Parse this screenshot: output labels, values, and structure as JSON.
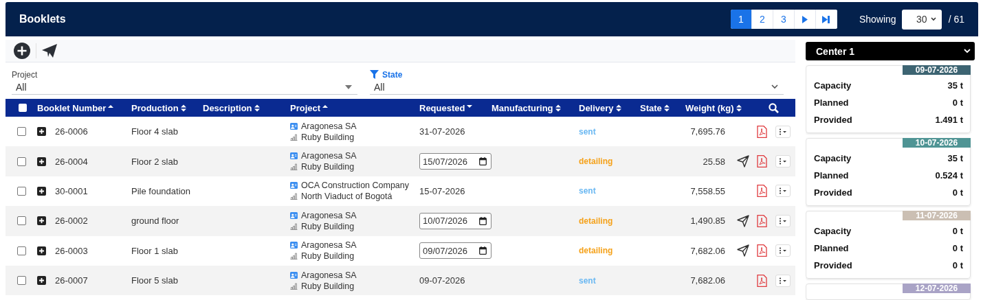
{
  "header": {
    "title": "Booklets",
    "pages": [
      {
        "label": "1",
        "selected": true
      },
      {
        "label": "2",
        "selected": false
      },
      {
        "label": "3",
        "selected": false
      }
    ],
    "showing_label": "Showing",
    "page_size": "30",
    "total": "/ 61"
  },
  "filters": [
    {
      "label": "Project",
      "value": "All",
      "filtered": false
    },
    {
      "label": "State",
      "value": "All",
      "filtered": true
    }
  ],
  "table": {
    "all_checked": false,
    "columns": [
      {
        "label": "Booklet Number",
        "kind": "asc"
      },
      {
        "label": "Production",
        "kind": "both"
      },
      {
        "label": "Description",
        "kind": "both"
      },
      {
        "label": "Project",
        "kind": "asc"
      },
      {
        "label": "Requested",
        "kind": "desc"
      },
      {
        "label": "Manufacturing",
        "kind": "both"
      },
      {
        "label": "Delivery",
        "kind": "both"
      },
      {
        "label": "State",
        "kind": "both"
      },
      {
        "label": "Weight (kg)",
        "kind": "both"
      }
    ],
    "rows": [
      {
        "checked": false,
        "number": "26-0006",
        "production": "Floor 4 slab",
        "client": "Aragonesa SA",
        "site": "Ruby Building",
        "requested": {
          "kind": "text",
          "value": "31-07-2026"
        },
        "delivery": {
          "text": "sent",
          "color": "#6ab8f2"
        },
        "weight": "7,695.76",
        "can_send": false
      },
      {
        "checked": false,
        "number": "26-0004",
        "production": "Floor 2 slab",
        "client": "Aragonesa SA",
        "site": "Ruby Building",
        "requested": {
          "kind": "input",
          "value": "15/07/2026"
        },
        "delivery": {
          "text": "detailing",
          "color": "#f5a21b"
        },
        "weight": "25.58",
        "can_send": true
      },
      {
        "checked": false,
        "number": "30-0001",
        "production": "Pile foundation",
        "client": "OCA Construction Company",
        "site": "North Viaduct of Bogotá",
        "requested": {
          "kind": "text",
          "value": "15-07-2026"
        },
        "delivery": {
          "text": "sent",
          "color": "#6ab8f2"
        },
        "weight": "7,558.55",
        "can_send": false
      },
      {
        "checked": false,
        "number": "26-0002",
        "production": "ground floor",
        "client": "Aragonesa SA",
        "site": "Ruby Building",
        "requested": {
          "kind": "input",
          "value": "10/07/2026"
        },
        "delivery": {
          "text": "detailing",
          "color": "#f5a21b"
        },
        "weight": "1,490.85",
        "can_send": true
      },
      {
        "checked": false,
        "number": "26-0003",
        "production": "Floor 1 slab",
        "client": "Aragonesa SA",
        "site": "Ruby Building",
        "requested": {
          "kind": "input",
          "value": "09/07/2026"
        },
        "delivery": {
          "text": "detailing",
          "color": "#f5a21b"
        },
        "weight": "7,682.06",
        "can_send": true
      },
      {
        "checked": false,
        "number": "26-0007",
        "production": "Floor 5 slab",
        "client": "Aragonesa SA",
        "site": "Ruby Building",
        "requested": {
          "kind": "text",
          "value": "09-07-2026"
        },
        "delivery": {
          "text": "sent",
          "color": "#6ab8f2"
        },
        "weight": "7,682.06",
        "can_send": false
      }
    ]
  },
  "center": {
    "value": "Center 1",
    "days": [
      {
        "date": "09-07-2026",
        "color": "#3d6472",
        "stats": [
          {
            "label": "Capacity",
            "value": "35 t"
          },
          {
            "label": "Planned",
            "value": "0 t"
          },
          {
            "label": "Provided",
            "value": "1.491 t"
          }
        ]
      },
      {
        "date": "10-07-2026",
        "color": "#4f9494",
        "stats": [
          {
            "label": "Capacity",
            "value": "35 t"
          },
          {
            "label": "Planned",
            "value": "0.524 t"
          },
          {
            "label": "Provided",
            "value": "0 t"
          }
        ]
      },
      {
        "date": "11-07-2026",
        "color": "#cbbfb3",
        "stats": [
          {
            "label": "Capacity",
            "value": "0 t"
          },
          {
            "label": "Planned",
            "value": "0 t"
          },
          {
            "label": "Provided",
            "value": "0 t"
          }
        ]
      },
      {
        "date": "12-07-2026",
        "color": "#a9a3c6"
      }
    ]
  }
}
